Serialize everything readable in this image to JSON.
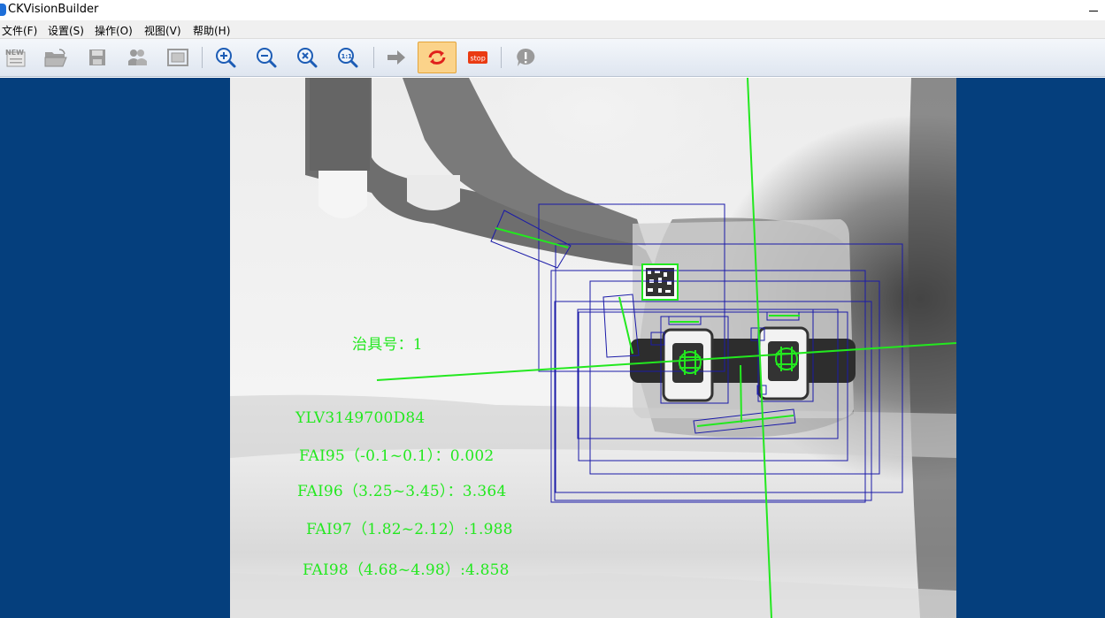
{
  "window": {
    "title": "CKVisionBuilder"
  },
  "menu": [
    {
      "label": "文件(F)"
    },
    {
      "label": "设置(S)"
    },
    {
      "label": "操作(O)"
    },
    {
      "label": "视图(V)"
    },
    {
      "label": "帮助(H)"
    }
  ],
  "toolbar": {
    "buttons": [
      {
        "name": "new-icon",
        "label": "NEW"
      },
      {
        "name": "open-folder-icon"
      },
      {
        "name": "save-icon"
      },
      {
        "name": "users-icon"
      },
      {
        "name": "fit-window-icon"
      },
      {
        "name": "zoom-in-icon"
      },
      {
        "name": "zoom-out-icon"
      },
      {
        "name": "zoom-fit-icon"
      },
      {
        "name": "zoom-actual-icon",
        "label": "1:1"
      },
      {
        "name": "run-once-icon"
      },
      {
        "name": "continuous-run-icon",
        "active": true
      },
      {
        "name": "stop-icon",
        "label": "stop"
      },
      {
        "name": "help-icon"
      }
    ]
  },
  "overlay": {
    "fixture_label": "治具号：1",
    "serial": "YLV3149700D84",
    "measurements": [
      "FAI95（-0.1~0.1）：0.002",
      "FAI96（3.25~3.45）：3.364",
      "FAI97（1.82~2.12）:1.988",
      "FAI98（4.68~4.98）:4.858"
    ]
  },
  "colors": {
    "workspace_bg": "#053f7d",
    "overlay_green": "#23e81f",
    "roi_blue": "#1a1aa8",
    "active_tool": "#fbd38a"
  }
}
